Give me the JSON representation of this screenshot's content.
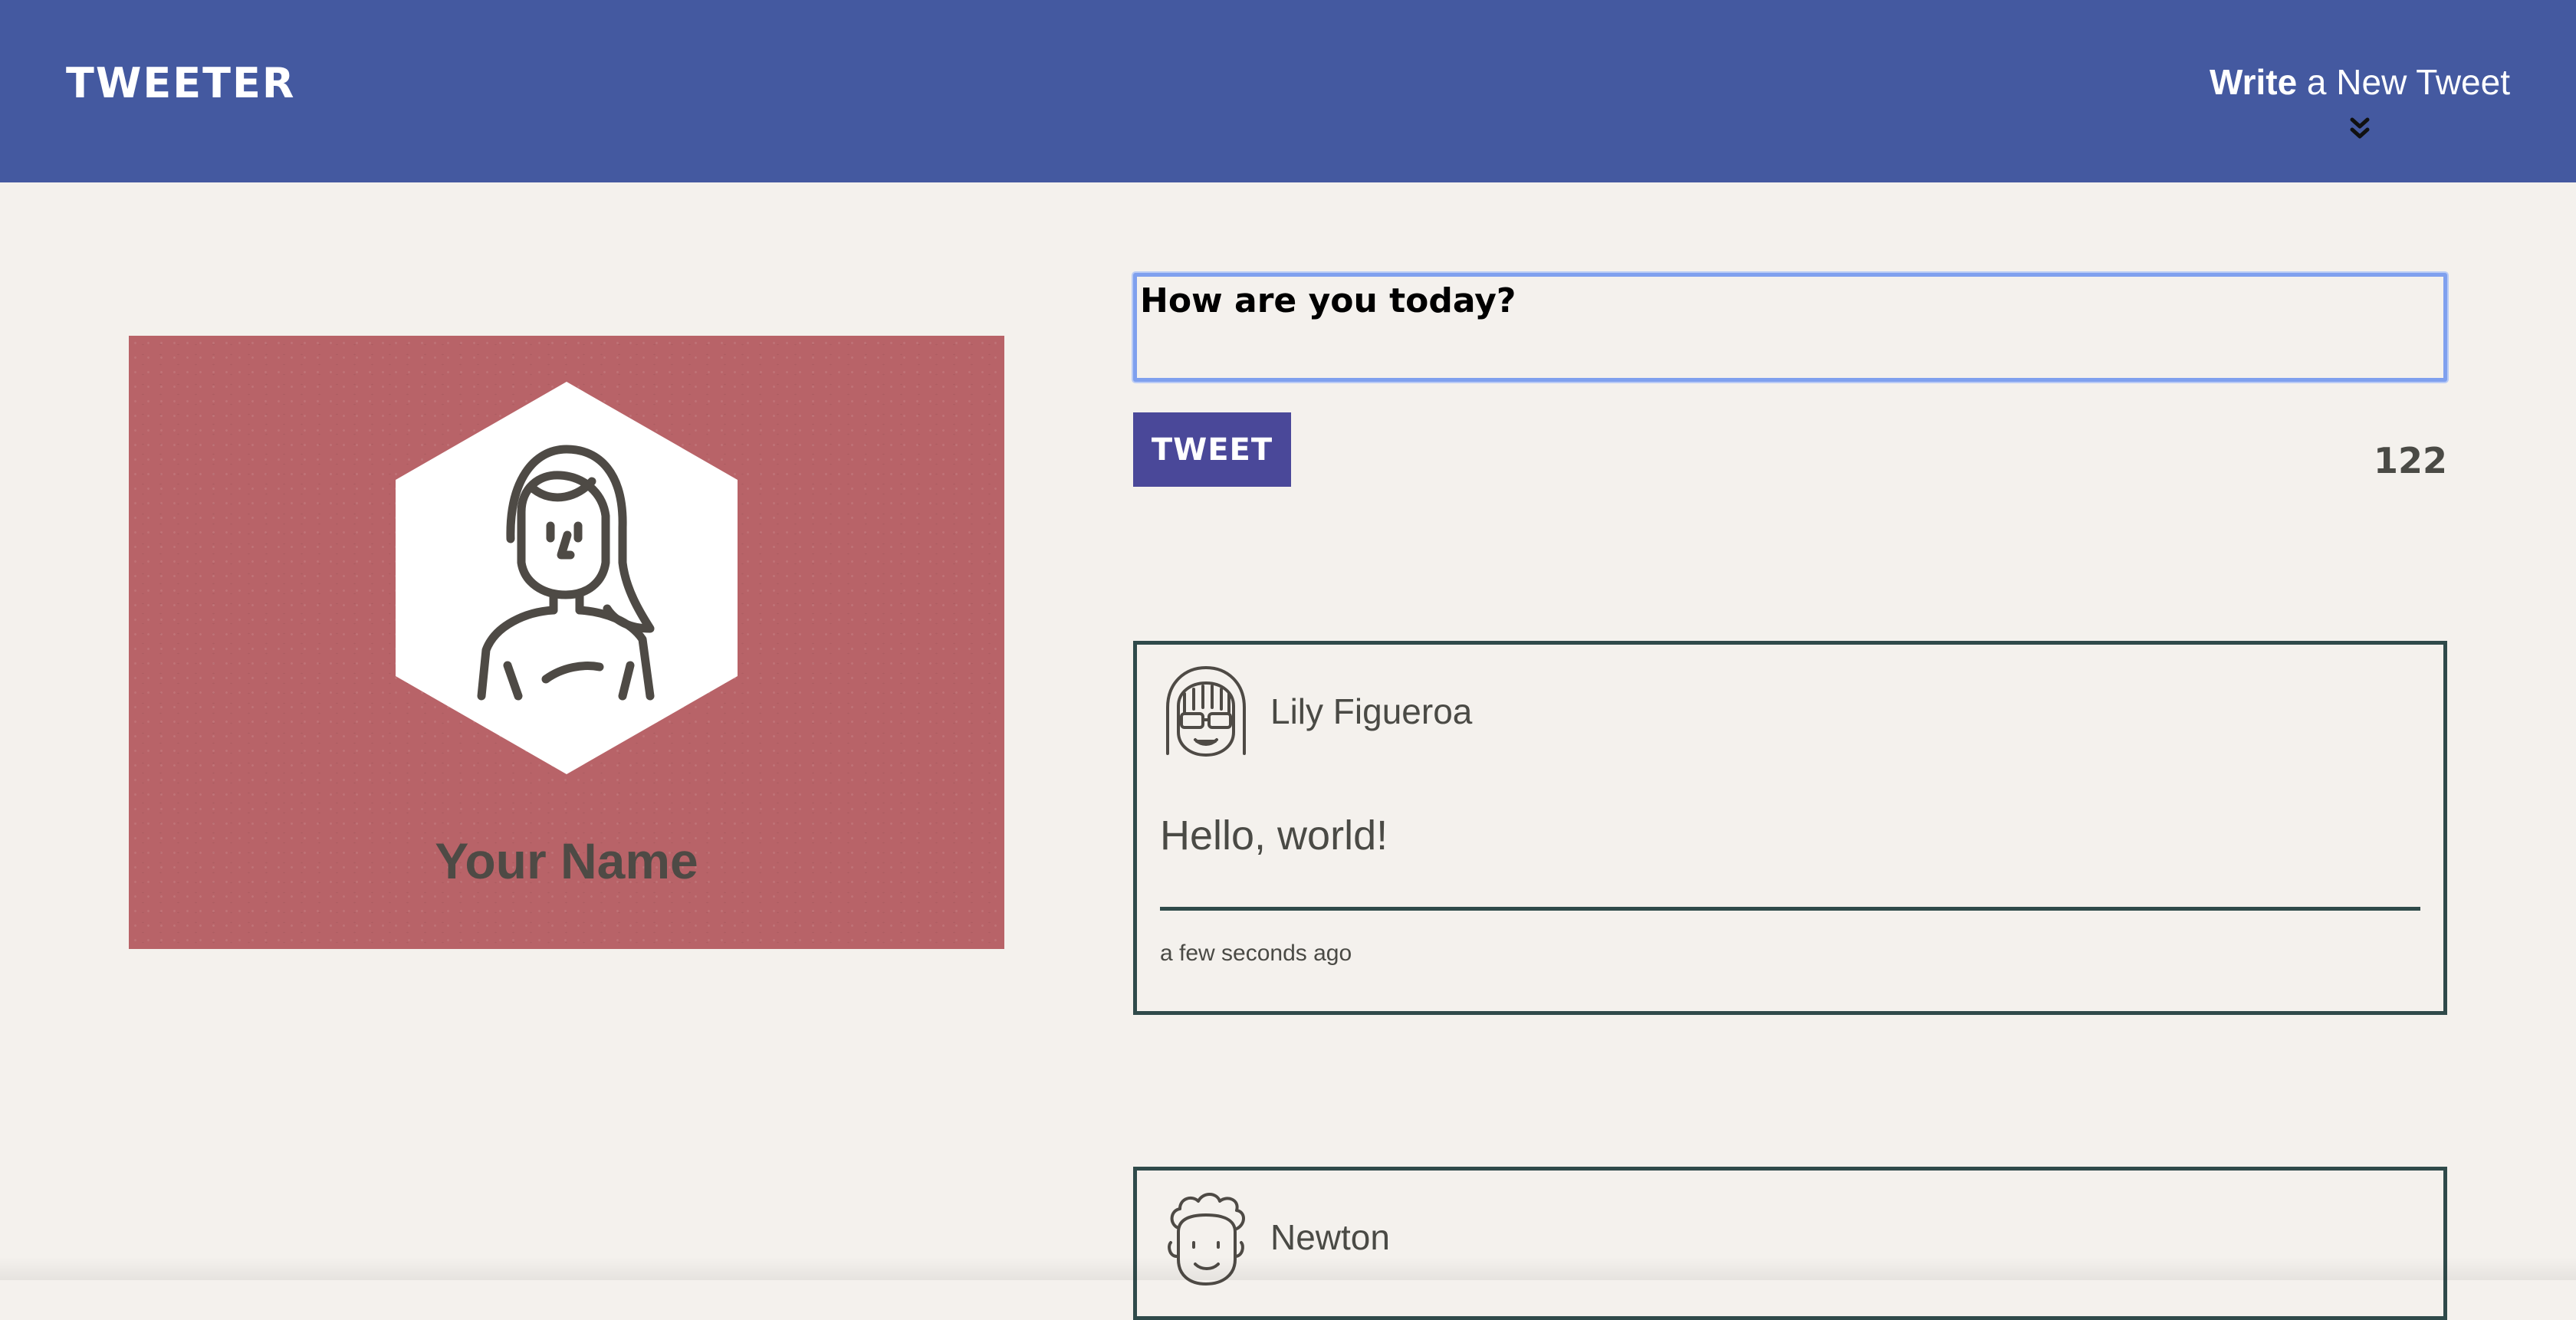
{
  "nav": {
    "brand": "TWEETER",
    "compose_strong": "Write",
    "compose_rest": " a New Tweet"
  },
  "profile": {
    "name": "Your Name"
  },
  "composer": {
    "text": "How are you today?",
    "button_label": "TWEET",
    "char_count": "122"
  },
  "tweets": [
    {
      "user": "Lily Figueroa",
      "text": "Hello, world!",
      "time": "a few seconds ago"
    },
    {
      "user": "Newton"
    }
  ],
  "colors": {
    "nav_bg": "#4459a0",
    "page_bg": "#f4f1ed",
    "profile_bg": "#b86368",
    "button_bg": "#4a4899",
    "tweet_border": "#2f4a4a",
    "focus_ring": "#7fa0ee"
  },
  "icons": {
    "nav_chevron": "double-chevron-down-icon",
    "profile_avatar": "woman-avatar-icon",
    "tweet_1_avatar": "girl-with-glasses-avatar-icon",
    "tweet_2_avatar": "curly-hair-avatar-icon"
  }
}
